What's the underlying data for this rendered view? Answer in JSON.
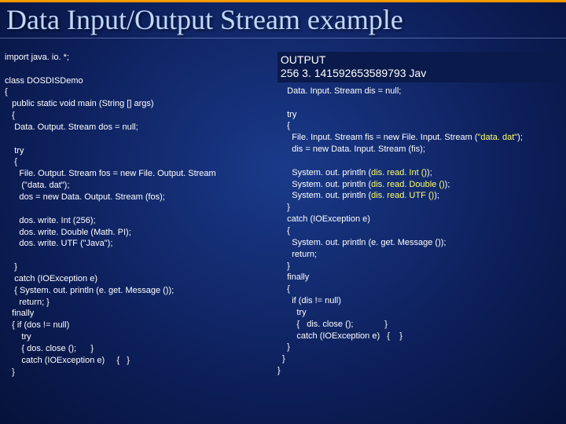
{
  "title": "Data Input/Output Stream example",
  "output": {
    "label": "OUTPUT",
    "line": "256 3. 141592653589793 Jav"
  },
  "left": {
    "l01": "import java. io. *;",
    "l02": "",
    "l03": "class DOSDISDemo",
    "l04": "{",
    "l05": "   public static void main (String [] args)",
    "l06": "   {",
    "l07": "    Data. Output. Stream dos = null;",
    "l08": "",
    "l09": "    try",
    "l10": "    {",
    "l11": "      File. Output. Stream fos = new File. Output. Stream",
    "l12": "       (\"data. dat\");",
    "l13": "      dos = new Data. Output. Stream (fos);",
    "l14": "",
    "l15": "      dos. write. Int (256);",
    "l16": "      dos. write. Double (Math. PI);",
    "l17": "      dos. write. UTF (\"Java\");",
    "l18": "",
    "l19": "    }",
    "l20": "    catch (IOException e)",
    "l21": "    { System. out. println (e. get. Message ());",
    "l22": "      return; }",
    "l23": "   finally",
    "l24": "   { if (dos != null)",
    "l25": "       try",
    "l26": "       { dos. close ();      }",
    "l27": "       catch (IOException e)     {   }",
    "l28": "   }"
  },
  "right": {
    "r01": "    Data. Input. Stream dis = null;",
    "r02": "",
    "r03": "    try",
    "r04": "    {",
    "r05a": "      File. Input. Stream fis = new File. Input. Stream (",
    "r05b": "\"data. dat\"",
    "r05c": ");",
    "r06": "      dis = new Data. Input. Stream (fis);",
    "r07": "",
    "r08a": "      System. out. println (",
    "r08b": "dis. read. Int ()",
    "r08c": ");",
    "r09a": "      System. out. println (",
    "r09b": "dis. read. Double ()",
    "r09c": ");",
    "r10a": "      System. out. println (",
    "r10b": "dis. read. UTF ()",
    "r10c": ");",
    "r11": "    }",
    "r12": "    catch (IOException e)",
    "r13": "    {",
    "r14": "      System. out. println (e. get. Message ());",
    "r15": "      return;",
    "r16": "    }",
    "r17": "    finally",
    "r18": "    {",
    "r19": "      if (dis != null)",
    "r20": "        try",
    "r21": "        {   dis. close ();             }",
    "r22": "        catch (IOException e)   {    }",
    "r23": "    }",
    "r24": "  }",
    "r25": "}"
  }
}
